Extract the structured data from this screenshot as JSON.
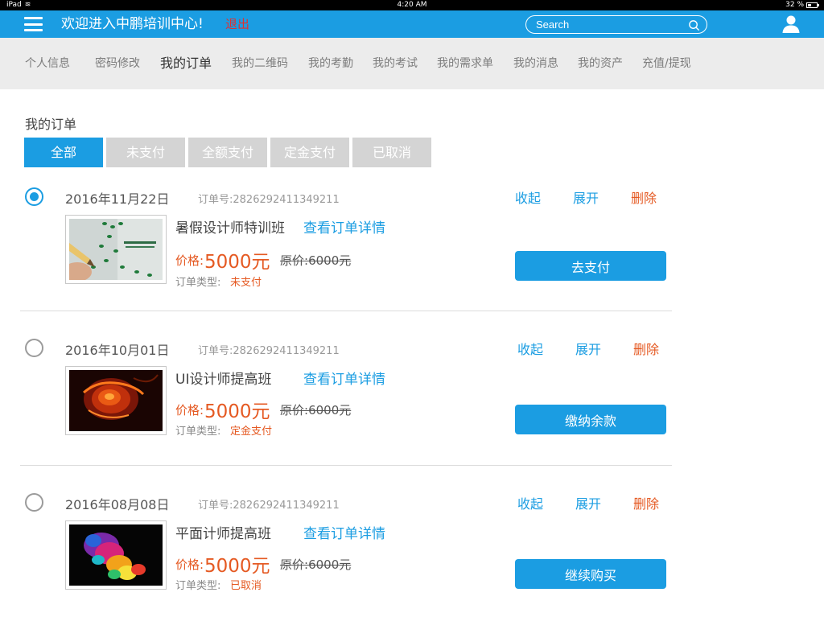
{
  "status_bar": {
    "device": "iPad",
    "time": "4:20 AM",
    "battery": "32 %"
  },
  "header": {
    "title": "欢迎进入中鹏培训中心!",
    "logout": "退出",
    "search_placeholder": "Search"
  },
  "subnav": {
    "items": [
      {
        "label": "个人信息"
      },
      {
        "label": "密码修改"
      },
      {
        "label": "我的订单"
      },
      {
        "label": "我的二维码"
      },
      {
        "label": "我的考勤"
      },
      {
        "label": "我的考试"
      },
      {
        "label": "我的需求单"
      },
      {
        "label": "我的消息"
      },
      {
        "label": "我的资产"
      },
      {
        "label": "充值/提现"
      }
    ],
    "active": "我的订单"
  },
  "section_title": "我的订单",
  "filter_tabs": [
    {
      "label": "全部"
    },
    {
      "label": "未支付"
    },
    {
      "label": "全额支付"
    },
    {
      "label": "定金支付"
    },
    {
      "label": "已取消"
    }
  ],
  "order_labels": {
    "order_no_label": "订单号:",
    "collapse": "收起",
    "expand": "展开",
    "delete": "删除",
    "view_detail": "查看订单详情",
    "price_label": "价格:",
    "orig_price_label": "原价:",
    "order_type_label": "订单类型:"
  },
  "orders": [
    {
      "selected": true,
      "date": "2016年11月22日",
      "order_no": "2826292411349211",
      "course": "暑假设计师特训班",
      "price": "5000元",
      "orig_price": "6000元",
      "order_type": "未支付",
      "button": "去支付",
      "image": "pencil-sketch-thumbnail"
    },
    {
      "selected": false,
      "date": "2016年10月01日",
      "order_no": "2826292411349211",
      "course": "UI设计师提高班",
      "price": "5000元",
      "orig_price": "6000元",
      "order_type": "定金支付",
      "button": "缴纳余款",
      "image": "fire-rose-thumbnail"
    },
    {
      "selected": false,
      "date": "2016年08月08日",
      "order_no": "2826292411349211",
      "course": "平面计师提高班",
      "price": "5000元",
      "orig_price": "6000元",
      "order_type": "已取消",
      "button": "继续购买",
      "image": "color-powder-thumbnail"
    }
  ],
  "colors": {
    "primary": "#1b9de2",
    "accent": "#e55a23",
    "nav_bg": "#ececec",
    "tab_inactive": "#d4d4d4"
  }
}
